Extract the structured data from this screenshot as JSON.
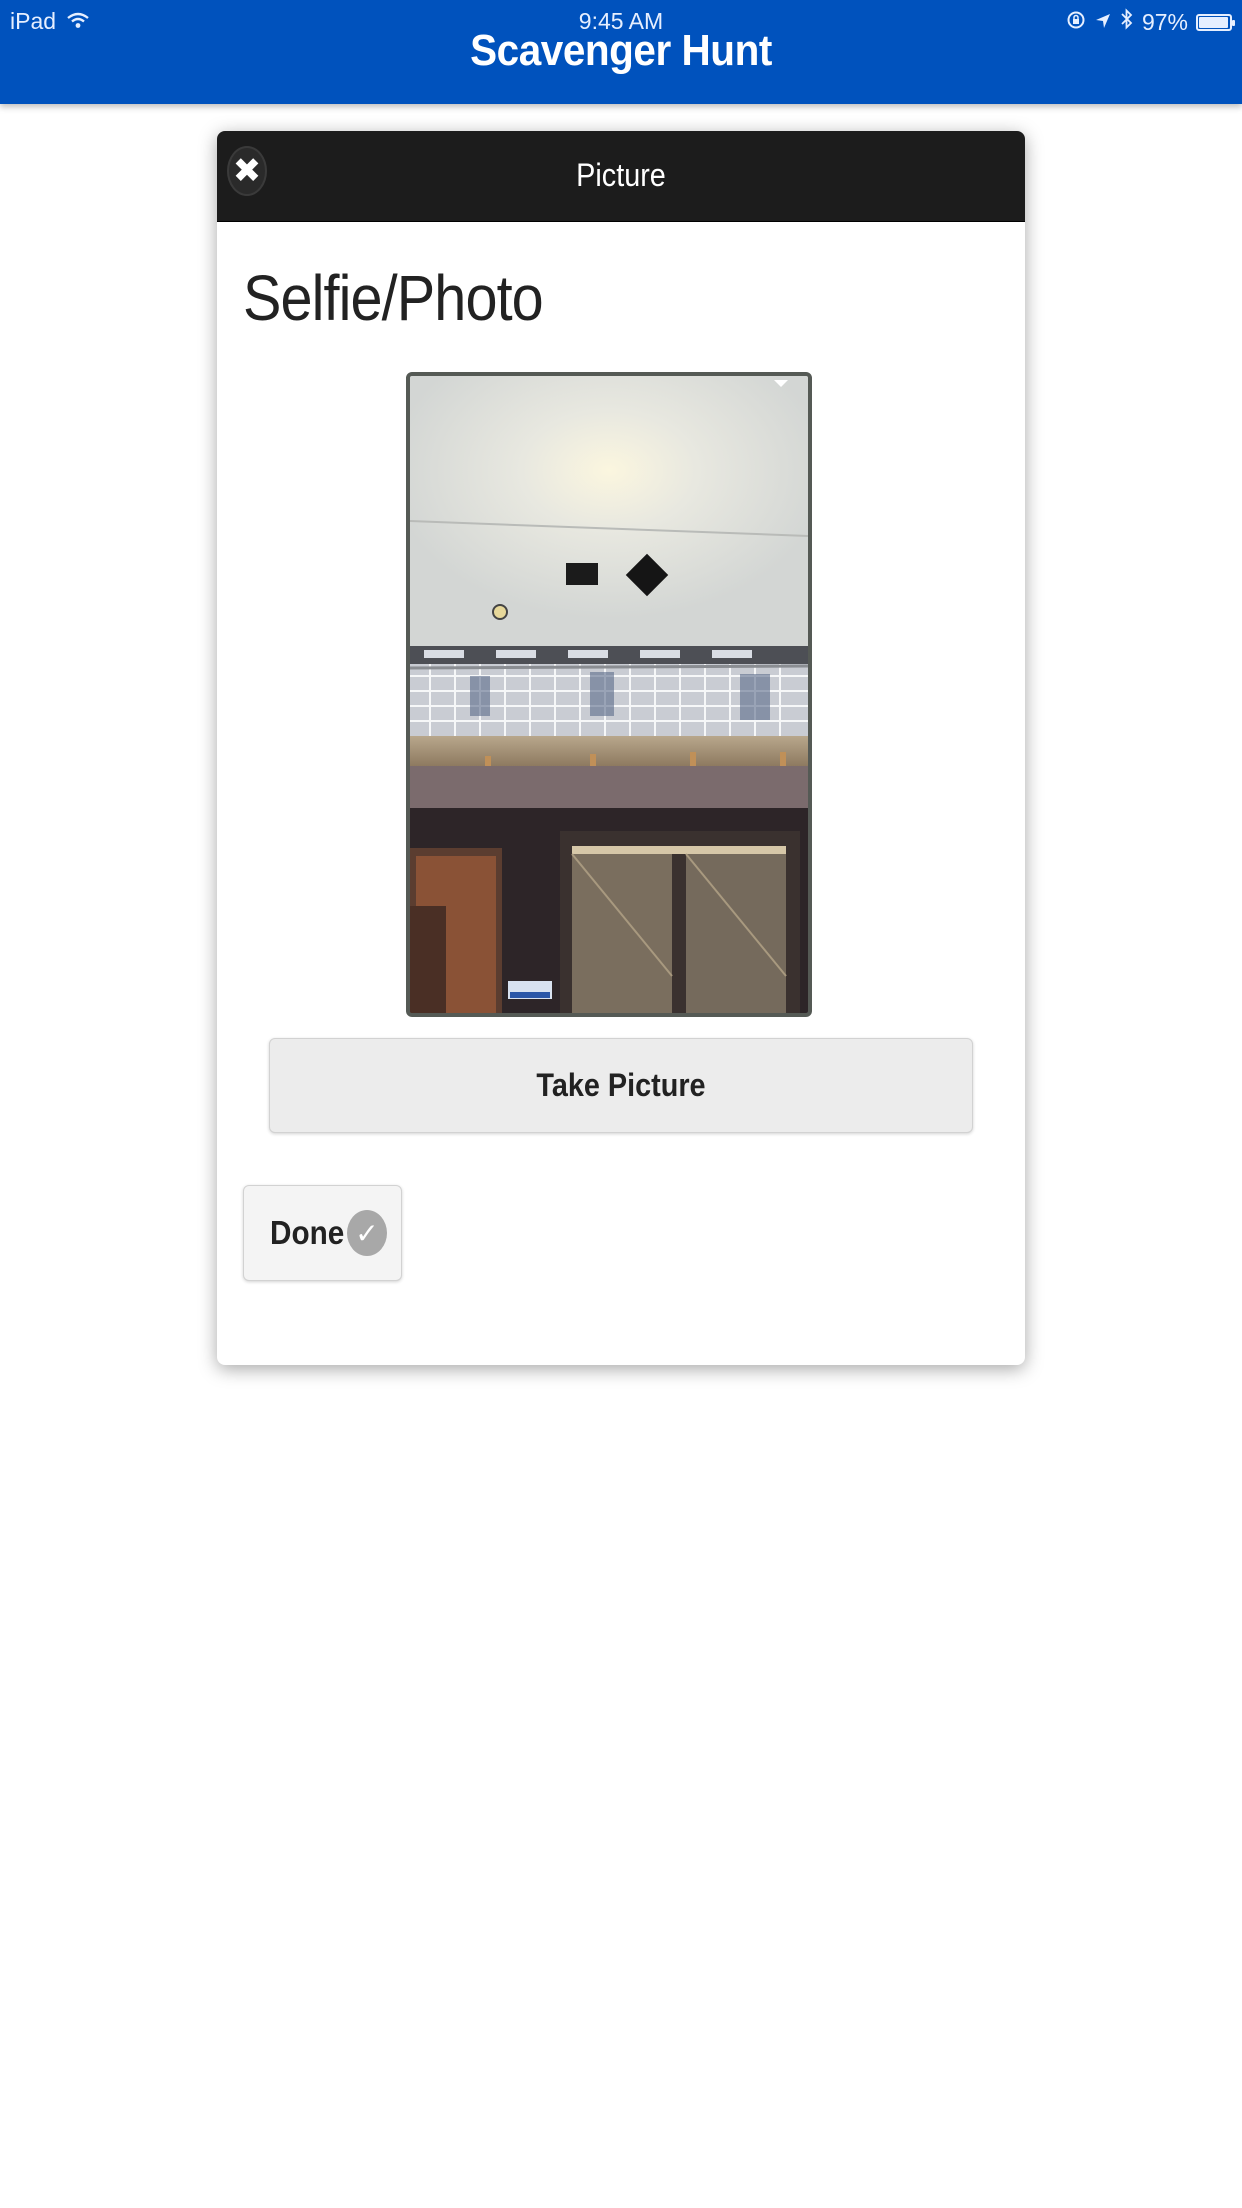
{
  "status_bar": {
    "device": "iPad",
    "time": "9:45 AM",
    "battery": "97%",
    "battery_level": 0.97,
    "icons": [
      "wifi-icon",
      "rotation-lock-icon",
      "location-icon",
      "bluetooth-icon",
      "battery-icon"
    ]
  },
  "header": {
    "title": "Scavenger Hunt",
    "color": "#0052bd"
  },
  "dialog": {
    "title": "Picture",
    "close_icon": "close-icon",
    "heading": "Selfie/Photo",
    "photo_description": "camera-preview-image",
    "take_picture_label": "Take Picture",
    "done_label": "Done",
    "done_icon": "check-circle-icon"
  }
}
